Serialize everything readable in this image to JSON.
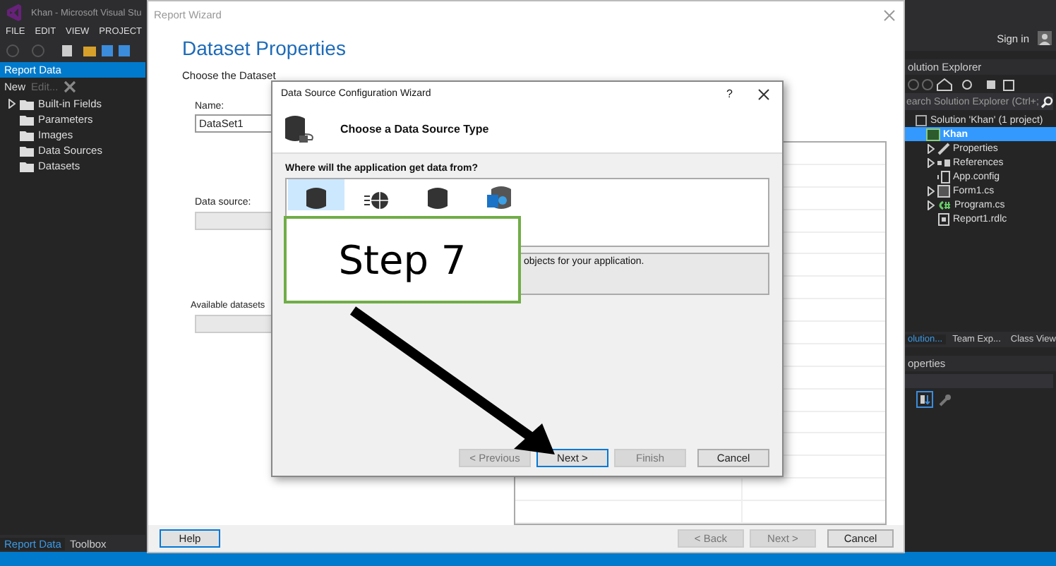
{
  "ide": {
    "title": "Khan - Microsoft Visual Stu",
    "menu": [
      "FILE",
      "EDIT",
      "VIEW",
      "PROJECT"
    ],
    "sign_in": "Sign in"
  },
  "report_data_panel": {
    "title": "Report Data",
    "toolbar": [
      {
        "label": "New",
        "disabled": false
      },
      {
        "label": "Edit...",
        "disabled": true
      }
    ],
    "items": [
      {
        "label": "Built-in Fields",
        "expandable": true
      },
      {
        "label": "Parameters",
        "expandable": false
      },
      {
        "label": "Images",
        "expandable": false
      },
      {
        "label": "Data Sources",
        "expandable": false
      },
      {
        "label": "Datasets",
        "expandable": false
      }
    ],
    "tabs": [
      {
        "label": "Report Data",
        "selected": true
      },
      {
        "label": "Toolbox",
        "selected": false
      }
    ]
  },
  "solution_explorer": {
    "title": "olution Explorer",
    "search": {
      "placeholder": "earch Solution Explorer (Ctrl+;"
    },
    "tree": [
      {
        "label": "Solution 'Khan' (1 project)",
        "kind": "solution",
        "selected": false,
        "expandable": false,
        "children": [
          {
            "label": "Khan",
            "kind": "project",
            "selected": true,
            "expandable": false,
            "children": [
              {
                "label": "Properties",
                "kind": "properties",
                "selected": false,
                "expandable": true
              },
              {
                "label": "References",
                "kind": "references",
                "selected": false,
                "expandable": true
              },
              {
                "label": "App.config",
                "kind": "config",
                "selected": false,
                "expandable": false
              },
              {
                "label": "Form1.cs",
                "kind": "form",
                "selected": false,
                "expandable": true
              },
              {
                "label": "Program.cs",
                "kind": "code",
                "selected": false,
                "expandable": true
              },
              {
                "label": "Report1.rdlc",
                "kind": "report",
                "selected": false,
                "expandable": false
              }
            ]
          }
        ]
      }
    ],
    "tabs": [
      {
        "label": "olution...",
        "selected": true
      },
      {
        "label": "Team Exp...",
        "selected": false
      },
      {
        "label": "Class View",
        "selected": false
      }
    ]
  },
  "properties_panel": {
    "title": "operties"
  },
  "report_wizard": {
    "title": "Report Wizard",
    "heading": "Dataset Properties",
    "subheading": "Choose the Dataset",
    "name_label": "Name:",
    "name_value": "DataSet1",
    "data_source_label": "Data source:",
    "available_label": "Available datasets",
    "buttons": [
      {
        "label": "Help",
        "disabled": false,
        "default": true
      },
      {
        "label": "< Back",
        "disabled": true,
        "default": false
      },
      {
        "label": "Next >",
        "disabled": true,
        "default": false
      },
      {
        "label": "Cancel",
        "disabled": false,
        "default": false
      }
    ]
  },
  "dialog": {
    "title": "Data Source Configuration Wizard",
    "help": "?",
    "heading": "Choose a Data Source Type",
    "question": "Where will the application get data from?",
    "source_types": [
      {
        "kind": "database",
        "selected": true
      },
      {
        "kind": "service",
        "selected": false
      },
      {
        "kind": "object",
        "selected": false
      },
      {
        "kind": "sharepoint",
        "selected": false
      }
    ],
    "description": "objects for your application.",
    "buttons": [
      {
        "label": "< Previous",
        "disabled": true,
        "default": false
      },
      {
        "label": "Next >",
        "disabled": false,
        "default": true
      },
      {
        "label": "Finish",
        "disabled": true,
        "default": false
      },
      {
        "label": "Cancel",
        "disabled": false,
        "default": false
      }
    ]
  },
  "callout": {
    "text": "Step 7"
  }
}
